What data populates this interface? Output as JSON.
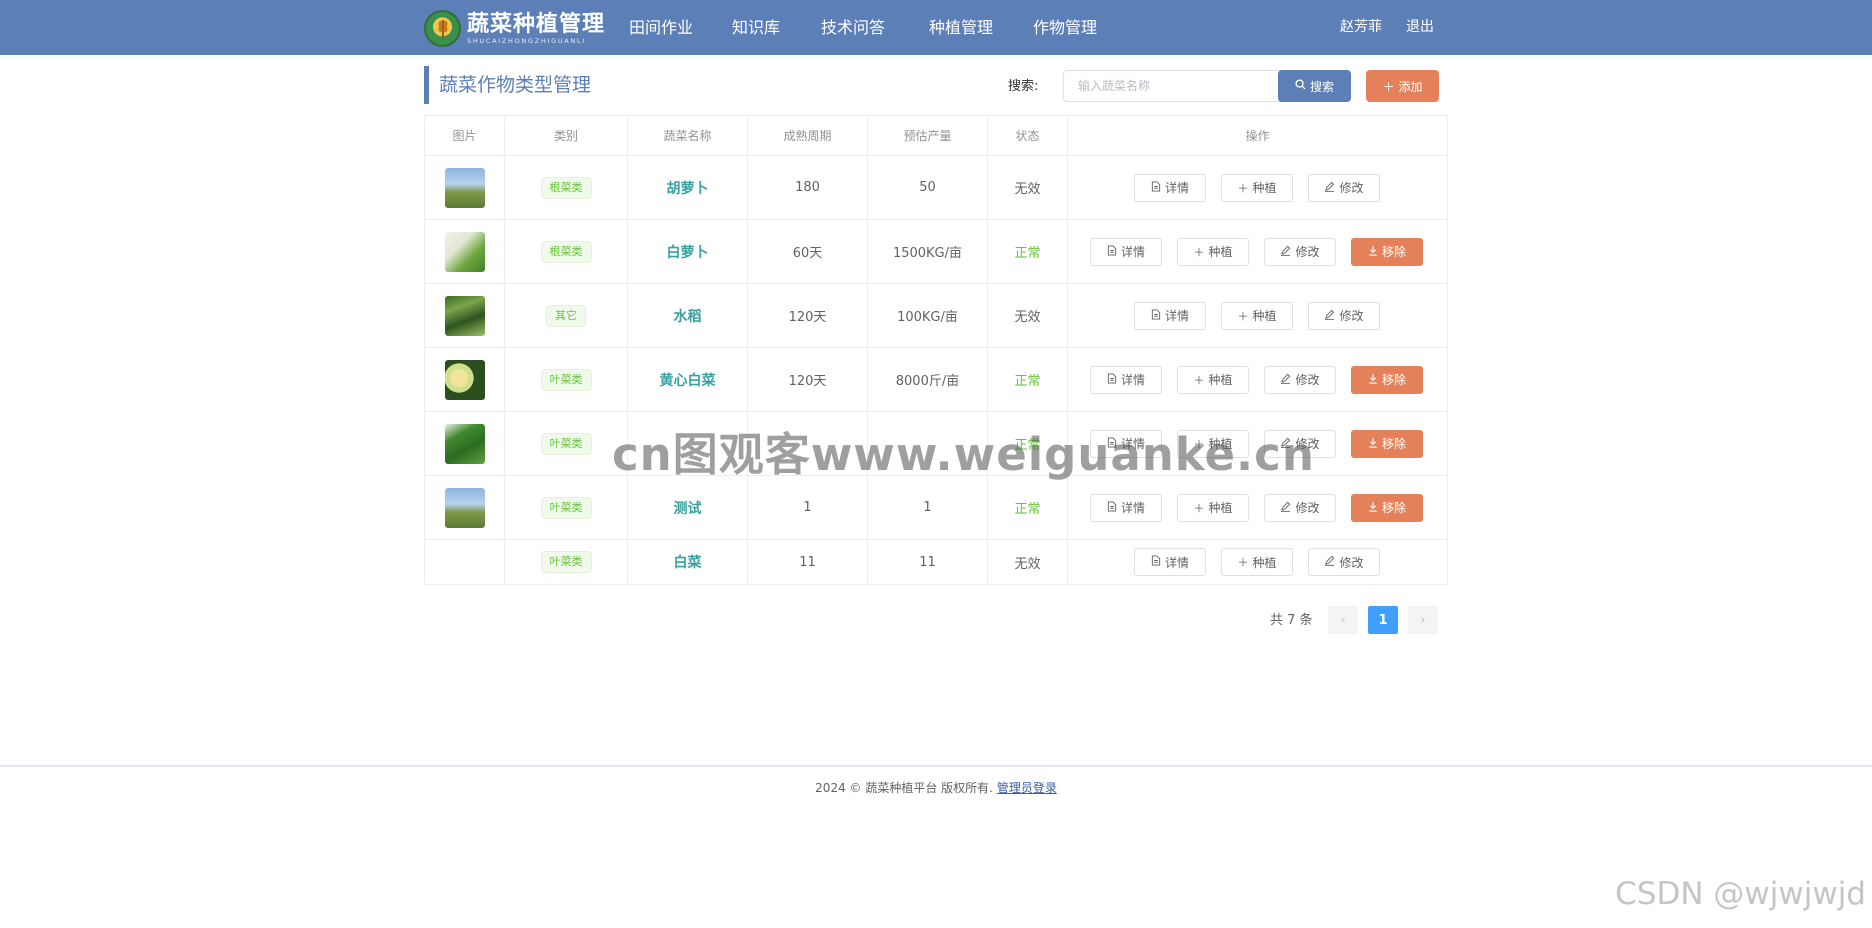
{
  "app": {
    "logo_title": "蔬菜种植管理",
    "logo_subtitle": "SHUCAIZHONGZHIGUANLI"
  },
  "nav": {
    "items": [
      "田间作业",
      "知识库",
      "技术问答",
      "种植管理",
      "作物管理"
    ],
    "user_name": "赵芳菲",
    "logout": "退出"
  },
  "page": {
    "title": "蔬菜作物类型管理",
    "search_label": "搜索:",
    "search_placeholder": "输入蔬菜名称",
    "search_value": "",
    "search_button": "搜索",
    "add_button": "添加"
  },
  "table": {
    "columns": [
      "图片",
      "类别",
      "蔬菜名称",
      "成熟周期",
      "预估产量",
      "状态",
      "操作"
    ],
    "action_labels": {
      "detail": "详情",
      "plant": "种植",
      "edit": "修改",
      "remove": "移除"
    },
    "rows": [
      {
        "image": "field-photo",
        "category": "根菜类",
        "name": "胡萝卜",
        "cycle": "180",
        "yield": "50",
        "status": "无效",
        "removable": false
      },
      {
        "image": "white-radish-photo",
        "category": "根菜类",
        "name": "白萝卜",
        "cycle": "60天",
        "yield": "1500KG/亩",
        "status": "正常",
        "removable": true
      },
      {
        "image": "rice-photo",
        "category": "其它",
        "name": "水稻",
        "cycle": "120天",
        "yield": "100KG/亩",
        "status": "无效",
        "removable": false
      },
      {
        "image": "cabbage-photo",
        "category": "叶菜类",
        "name": "黄心白菜",
        "cycle": "120天",
        "yield": "8000斤/亩",
        "status": "正常",
        "removable": true
      },
      {
        "image": "spinach-photo",
        "category": "叶菜类",
        "name": "",
        "cycle": "",
        "yield": "",
        "status": "正常",
        "removable": true
      },
      {
        "image": "field-photo",
        "category": "叶菜类",
        "name": "测试",
        "cycle": "1",
        "yield": "1",
        "status": "正常",
        "removable": true
      },
      {
        "image": "",
        "category": "叶菜类",
        "name": "白菜",
        "cycle": "11",
        "yield": "11",
        "status": "无效",
        "removable": false
      }
    ]
  },
  "pagination": {
    "total_label": "共 7 条",
    "current_page": "1"
  },
  "footer": {
    "text": "2024 © 蔬菜种植平台 版权所有.",
    "link": "管理员登录"
  },
  "watermarks": {
    "center": "cn图观客www.weiguanke.cn",
    "corner": "CSDN @wjwjwjd"
  },
  "colors": {
    "header": "#5c7fb8",
    "accent_orange": "#e4805a",
    "status_ok": "#67c23a",
    "name_teal": "#37a2a0",
    "page_active": "#409eff"
  }
}
